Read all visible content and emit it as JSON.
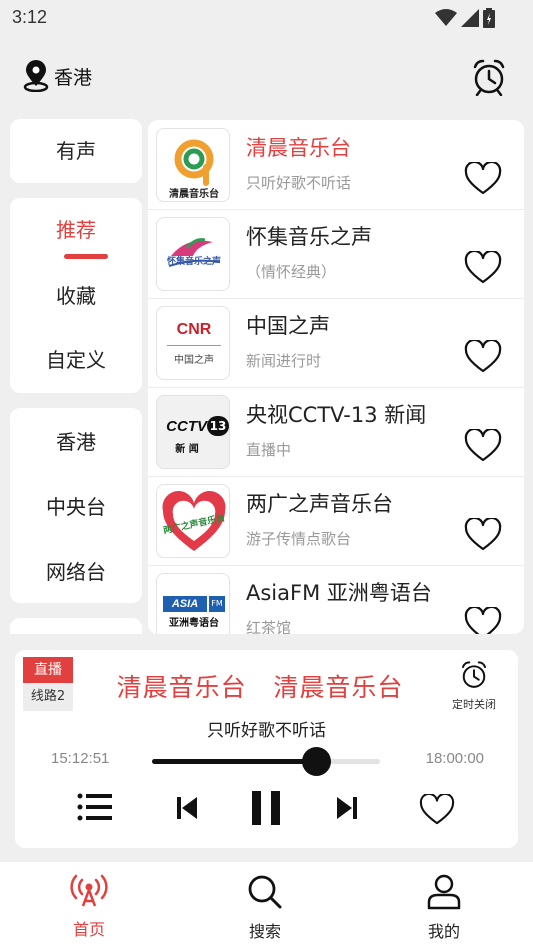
{
  "status": {
    "time": "3:12"
  },
  "header": {
    "location": "香港"
  },
  "sidebar": {
    "group1": [
      "有声"
    ],
    "group2": [
      "推荐",
      "收藏",
      "自定义"
    ],
    "group3": [
      "香港",
      "中央台",
      "网络台"
    ]
  },
  "stations": [
    {
      "name": "清晨音乐台",
      "sub": "只听好歌不听话",
      "active": true,
      "logo": {
        "text": "清晨音乐台",
        "icon": "q-logo"
      }
    },
    {
      "name": "怀集音乐之声",
      "sub": "（情怀经典）",
      "active": false,
      "logo": {
        "text": "怀集音乐之声",
        "icon": "bird-logo"
      }
    },
    {
      "name": "中国之声",
      "sub": "新闻进行时",
      "active": false,
      "logo": {
        "text": "CNR",
        "sub": "中国之声",
        "icon": "cnr-logo"
      }
    },
    {
      "name": "央视CCTV-13 新闻",
      "sub": "直播中",
      "active": false,
      "logo": {
        "text": "CCTV",
        "badge": "13",
        "sub": "新 闻",
        "icon": "cctv-logo"
      }
    },
    {
      "name": "两广之声音乐台",
      "sub": "游子传情点歌台",
      "active": false,
      "logo": {
        "text": "两广之声音乐台",
        "icon": "heart-logo"
      }
    },
    {
      "name": "AsiaFM 亚洲粤语台",
      "sub": "红茶馆",
      "active": false,
      "logo": {
        "text": "ASIA",
        "sub": "亚洲粤语台",
        "icon": "asiafm-logo"
      }
    }
  ],
  "player": {
    "badge_live": "直播",
    "badge_line": "线路2",
    "title": "清晨音乐台   清晨音乐台",
    "subtitle": "只听好歌不听话",
    "timer_label": "定时关闭",
    "time_start": "15:12:51",
    "time_end": "18:00:00",
    "progress": 0.72
  },
  "tabs": [
    {
      "label": "首页",
      "icon": "radio-icon",
      "active": true
    },
    {
      "label": "搜索",
      "icon": "search-icon",
      "active": false
    },
    {
      "label": "我的",
      "icon": "user-icon",
      "active": false
    }
  ],
  "colors": {
    "accent": "#e2403f",
    "background": "#efefef"
  }
}
